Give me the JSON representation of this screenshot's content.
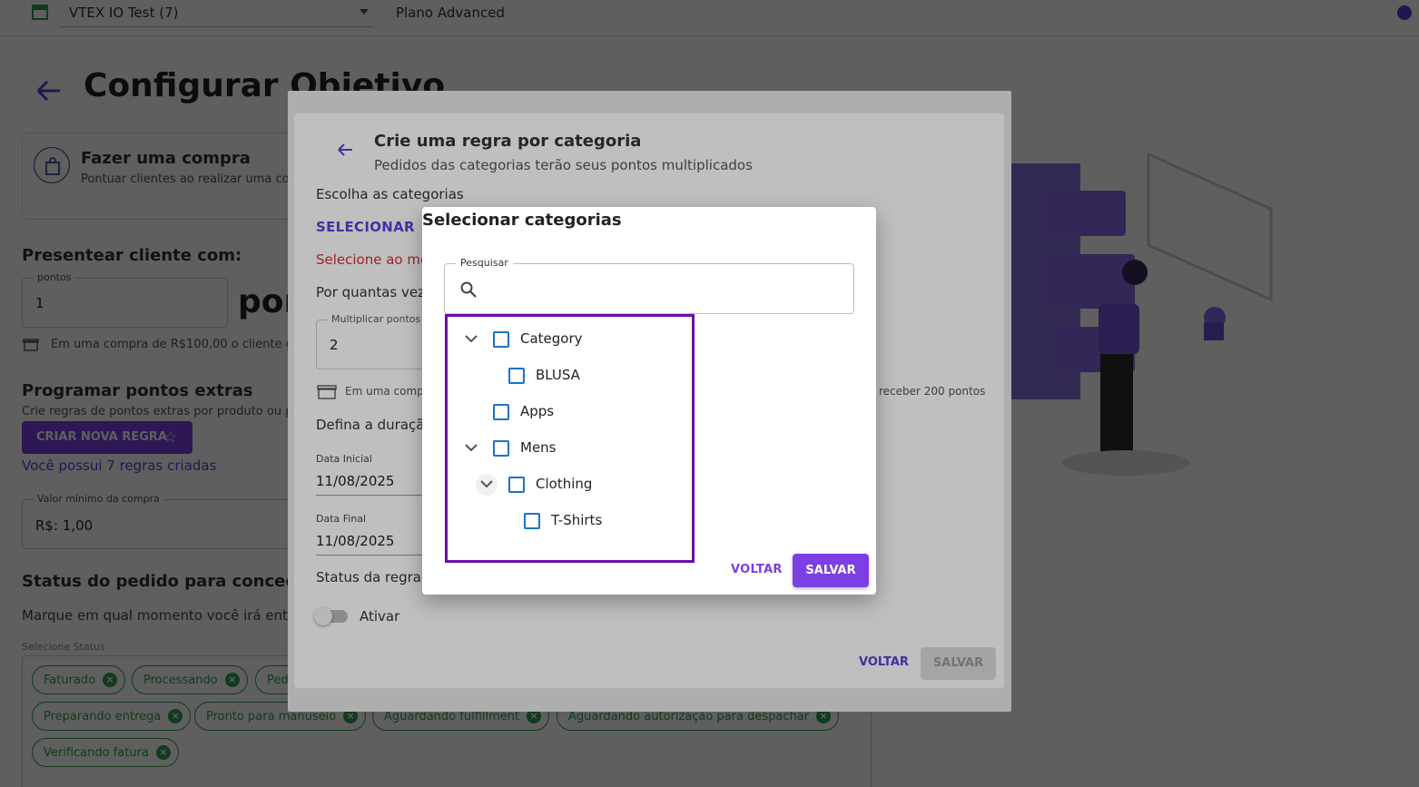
{
  "topbar": {
    "store_name": "VTEX IO Test (7)",
    "plan": "Plano Advanced"
  },
  "page": {
    "title": "Configurar Objetivo",
    "purchase_card": {
      "title": "Fazer uma compra",
      "subtitle": "Pontuar clientes ao realizar uma co"
    },
    "present": {
      "title": "Presentear cliente com:",
      "points_legend": "pontos",
      "points_value": "1",
      "points_unit": "pon",
      "hint": "Em uma compra de R$100,00 o cliente ga"
    },
    "extras": {
      "title": "Programar pontos extras",
      "subtitle": "Crie regras de pontos extras por produto ou pr",
      "create_button": "CRIAR NOVA REGRA",
      "rules_link": "Você possui 7 regras criadas"
    },
    "min_value": {
      "legend": "Valor mínimo da compra",
      "value": "R$:  1,00"
    },
    "status": {
      "title": "Status do pedido para conceder",
      "subtitle": "Marque em qual momento você irá entre",
      "select_label": "Selecione Status",
      "chips": [
        "Faturado",
        "Processando",
        "Ped",
        "Preparando entrega",
        "Pronto para manuseio",
        "Aguardando fulfillment",
        "Aguardando autorização para despachar",
        "Verificando fatura"
      ]
    }
  },
  "dialog": {
    "title": "Crie uma regra por categoria",
    "subtitle": "Pedidos das categorias terão seus pontos multiplicados",
    "choose_label": "Escolha as categorias",
    "select_link": "SELECIONAR",
    "error": "Selecione ao me",
    "times_label": "Por quantas vez",
    "multiplier_legend": "Multiplicar pontos",
    "multiplier_value": "2",
    "hint_left": "Em uma compr",
    "hint_right": "receber 200 pontos",
    "duration_label": "Defina a duraçã",
    "start_label": "Data Inicial",
    "start_value": "11/08/2025",
    "end_label": "Data Final",
    "end_value": "11/08/2025",
    "rule_status_label": "Status da regra",
    "toggle_label": "Ativar",
    "back": "VOLTAR",
    "save": "SALVAR"
  },
  "modal": {
    "title": "Selecionar categorias",
    "search_legend": "Pesquisar",
    "search_value": "",
    "tree": [
      {
        "label": "Category"
      },
      {
        "label": "BLUSA"
      },
      {
        "label": "Apps"
      },
      {
        "label": "Mens"
      },
      {
        "label": "Clothing"
      },
      {
        "label": "T-Shirts"
      }
    ],
    "back": "VOLTAR",
    "save": "SALVAR"
  },
  "colors": {
    "accent": "#7b3fe4",
    "link": "#5b3fd6",
    "error": "#d32f2f",
    "checkbox": "#1a73c8",
    "highlight_frame": "#6a0dad",
    "chip": "#2e9e4f"
  }
}
